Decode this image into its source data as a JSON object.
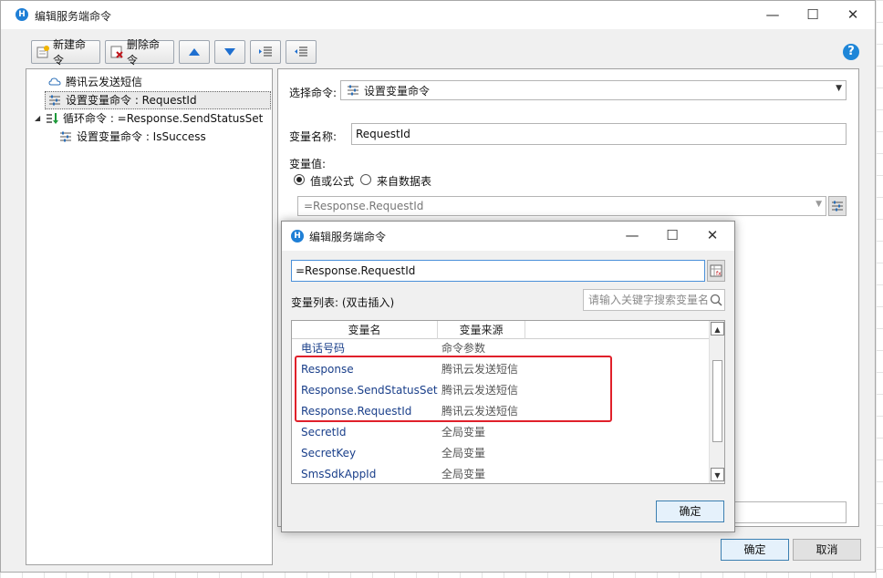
{
  "window": {
    "title": "编辑服务端命令",
    "logo_letter": "H"
  },
  "toolbar": {
    "new_label": "新建命令",
    "delete_label": "删除命令",
    "help": "?"
  },
  "tree": {
    "items": [
      {
        "label": "腾讯云发送短信"
      },
      {
        "label": "设置变量命令 : RequestId"
      },
      {
        "label": "循环命令 : =Response.SendStatusSet"
      },
      {
        "label": "设置变量命令 : IsSuccess"
      }
    ],
    "expander": "◢"
  },
  "form": {
    "select_command_label": "选择命令:",
    "select_command_value": "设置变量命令",
    "var_name_label": "变量名称:",
    "var_name_value": "RequestId",
    "var_value_label": "变量值:",
    "radio_formula": "值或公式",
    "radio_datatable": "来自数据表",
    "formula_value": "=Response.RequestId"
  },
  "footer": {
    "ok": "确定",
    "cancel": "取消"
  },
  "dialog": {
    "title": "编辑服务端命令",
    "formula": "=Response.RequestId",
    "var_list_label": "变量列表: (双击插入)",
    "search_placeholder": "请输入关键字搜索变量名",
    "col_name": "变量名",
    "col_source": "变量来源",
    "rows": [
      {
        "name": "电话号码",
        "source": "命令参数"
      },
      {
        "name": "Response",
        "source": "腾讯云发送短信"
      },
      {
        "name": "Response.SendStatusSet",
        "source": "腾讯云发送短信"
      },
      {
        "name": "Response.RequestId",
        "source": "腾讯云发送短信"
      },
      {
        "name": "SecretId",
        "source": "全局变量"
      },
      {
        "name": "SecretKey",
        "source": "全局变量"
      },
      {
        "name": "SmsSdkAppId",
        "source": "全局变量"
      }
    ],
    "ok": "确定"
  },
  "win_controls": {
    "minimize": "—",
    "maximize": "☐",
    "close": "✕"
  }
}
